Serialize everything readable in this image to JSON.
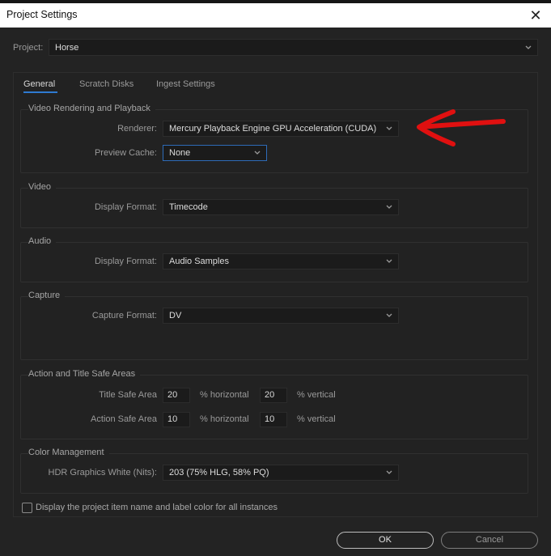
{
  "window": {
    "title": "Project Settings",
    "close_icon": "close-icon"
  },
  "project": {
    "label": "Project:",
    "value": "Horse"
  },
  "tabs": [
    {
      "label": "General",
      "active": true
    },
    {
      "label": "Scratch Disks",
      "active": false
    },
    {
      "label": "Ingest Settings",
      "active": false
    }
  ],
  "groups": {
    "video_rendering": {
      "title": "Video Rendering and Playback",
      "renderer_label": "Renderer:",
      "renderer_value": "Mercury Playback Engine GPU Acceleration (CUDA)",
      "preview_cache_label": "Preview Cache:",
      "preview_cache_value": "None"
    },
    "video": {
      "title": "Video",
      "display_format_label": "Display Format:",
      "display_format_value": "Timecode"
    },
    "audio": {
      "title": "Audio",
      "display_format_label": "Display Format:",
      "display_format_value": "Audio Samples"
    },
    "capture": {
      "title": "Capture",
      "capture_format_label": "Capture Format:",
      "capture_format_value": "DV"
    },
    "safe_areas": {
      "title": "Action and Title Safe Areas",
      "title_safe_label": "Title Safe Area",
      "title_safe_horizontal": "20",
      "title_safe_vertical": "20",
      "action_safe_label": "Action Safe Area",
      "action_safe_horizontal": "10",
      "action_safe_vertical": "10",
      "horizontal_unit": "% horizontal",
      "vertical_unit": "% vertical"
    },
    "color_management": {
      "title": "Color Management",
      "hdr_label": "HDR Graphics White (Nits):",
      "hdr_value": "203 (75% HLG, 58% PQ)"
    }
  },
  "display_item_name_checkbox": {
    "label": "Display the project item name and label color for all instances",
    "checked": false
  },
  "buttons": {
    "ok": "OK",
    "cancel": "Cancel"
  },
  "colors": {
    "accent": "#2e7ad1",
    "annotation_arrow": "#e01010",
    "background": "#232323"
  }
}
